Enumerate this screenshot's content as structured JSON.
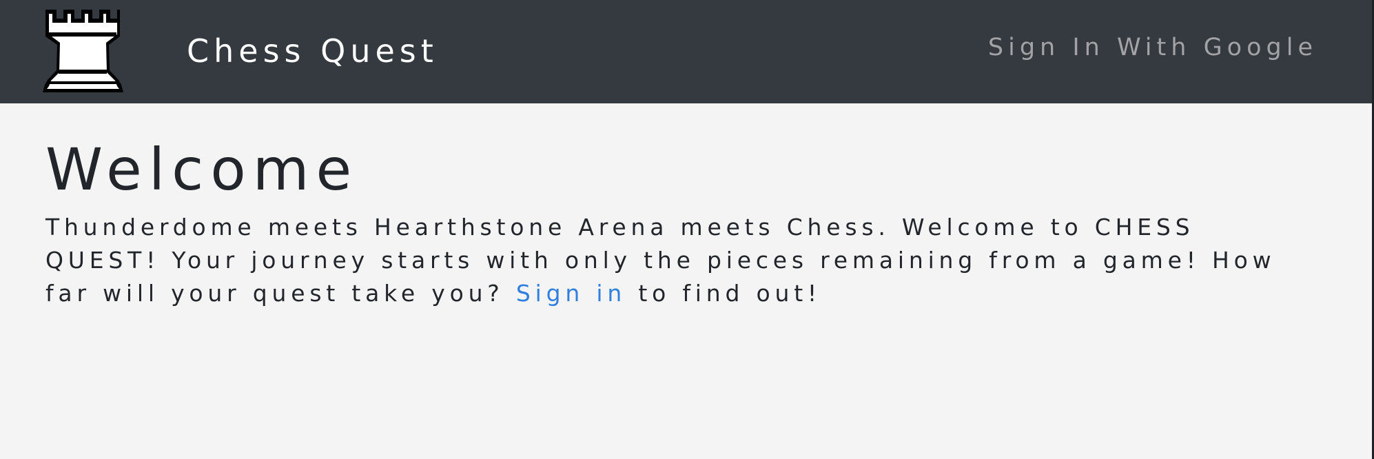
{
  "navbar": {
    "brand_name": "Chess Quest",
    "logo_icon": "chess-rook-icon",
    "sign_in_google_label": "Sign In With Google"
  },
  "main": {
    "title": "Welcome",
    "intro_text": "Thunderdome meets Hearthstone Arena meets Chess. Welcome to CHESS QUEST! Your journey starts with only the pieces remaining from a game! How far will your quest take you? ",
    "sign_in_link": "Sign in",
    "intro_suffix": " to find out!"
  },
  "colors": {
    "navbar_bg": "#343a40",
    "page_bg": "#f4f4f4",
    "link": "#2f7fe0",
    "muted_nav_text": "#a1a3a6",
    "text": "#22262b"
  }
}
